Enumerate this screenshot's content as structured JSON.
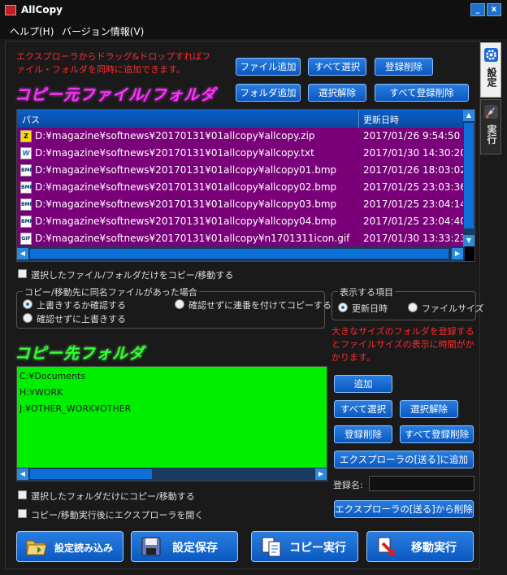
{
  "window": {
    "title": "AllCopy",
    "minimize_label": "_",
    "close_label": "x"
  },
  "menu": {
    "help": "ヘルプ(H)",
    "version": "バージョン情報(V)"
  },
  "source": {
    "notice_line1": "エクスプローラからドラッグ&ドロップすればフ",
    "notice_line2": "ァイル・フォルダを同時に追加できます。",
    "heading": "コピー元ファイル/フォルダ",
    "buttons": {
      "add_file": "ファイル追加",
      "select_all": "すべて選択",
      "delete_reg": "登録削除",
      "add_folder": "フォルダ追加",
      "deselect": "選択解除",
      "delete_all": "すべて登録削除"
    },
    "columns": {
      "path": "パス",
      "date": "更新日時"
    },
    "rows": [
      {
        "icon": "zip",
        "icon_text": "Z",
        "path": "D:¥magazine¥softnews¥20170131¥01allcopy¥allcopy.zip",
        "date": "2017/01/26  9:54:50"
      },
      {
        "icon": "txt",
        "icon_text": "W",
        "path": "D:¥magazine¥softnews¥20170131¥01allcopy¥allcopy.txt",
        "date": "2017/01/30 14:30:20"
      },
      {
        "icon": "bmp",
        "icon_text": "BMP",
        "path": "D:¥magazine¥softnews¥20170131¥01allcopy¥allcopy01.bmp",
        "date": "2017/01/26 18:03:02"
      },
      {
        "icon": "bmp",
        "icon_text": "BMP",
        "path": "D:¥magazine¥softnews¥20170131¥01allcopy¥allcopy02.bmp",
        "date": "2017/01/25 23:03:36"
      },
      {
        "icon": "bmp",
        "icon_text": "BMP",
        "path": "D:¥magazine¥softnews¥20170131¥01allcopy¥allcopy03.bmp",
        "date": "2017/01/25 23:04:14"
      },
      {
        "icon": "bmp",
        "icon_text": "BMP",
        "path": "D:¥magazine¥softnews¥20170131¥01allcopy¥allcopy04.bmp",
        "date": "2017/01/25 23:04:40"
      },
      {
        "icon": "gif",
        "icon_text": "GIF",
        "path": "D:¥magazine¥softnews¥20170131¥01allcopy¥n1701311icon.gif",
        "date": "2017/01/30 13:33:23"
      }
    ],
    "only_selected_label": "選択したファイル/フォルダだけをコピー/移動する"
  },
  "same_name": {
    "title": "コピー/移動先に同名ファイルがあった場合",
    "opt_confirm": "上書きするか確認する",
    "opt_number": "確認せずに連番を付けてコピーする",
    "opt_overwrite": "確認せずに上書きする"
  },
  "display_item": {
    "title": "表示する項目",
    "opt_date": "更新日時",
    "opt_size": "ファイルサイズ"
  },
  "size_warning": {
    "line1": "大きなサイズのフォルダを登録する",
    "line2": "とファイルサイズの表示に時間がか",
    "line3": "かります。"
  },
  "dest": {
    "heading": "コピー先フォルダ",
    "items": [
      "C:¥Documents",
      "H:¥WORK",
      "J:¥OTHER_WORK¥OTHER"
    ],
    "buttons": {
      "add": "追加",
      "select_all": "すべて選択",
      "deselect": "選択解除",
      "delete_reg": "登録削除",
      "delete_all": "すべて登録削除",
      "add_sendto": "エクスプローラの[送る]に追加",
      "remove_sendto": "エクスプローラの[送る]から削除"
    },
    "reg_name_label": "登録名:",
    "only_selected_label": "選択したフォルダだけにコピー/移動する",
    "open_explorer_label": "コピー/移動実行後にエクスプローラを開く"
  },
  "actions": {
    "load": "設定読み込み",
    "save": "設定保存",
    "copy": "コピー実行",
    "move": "移動実行"
  },
  "tabs": {
    "settings": "設定",
    "run": "実行"
  }
}
